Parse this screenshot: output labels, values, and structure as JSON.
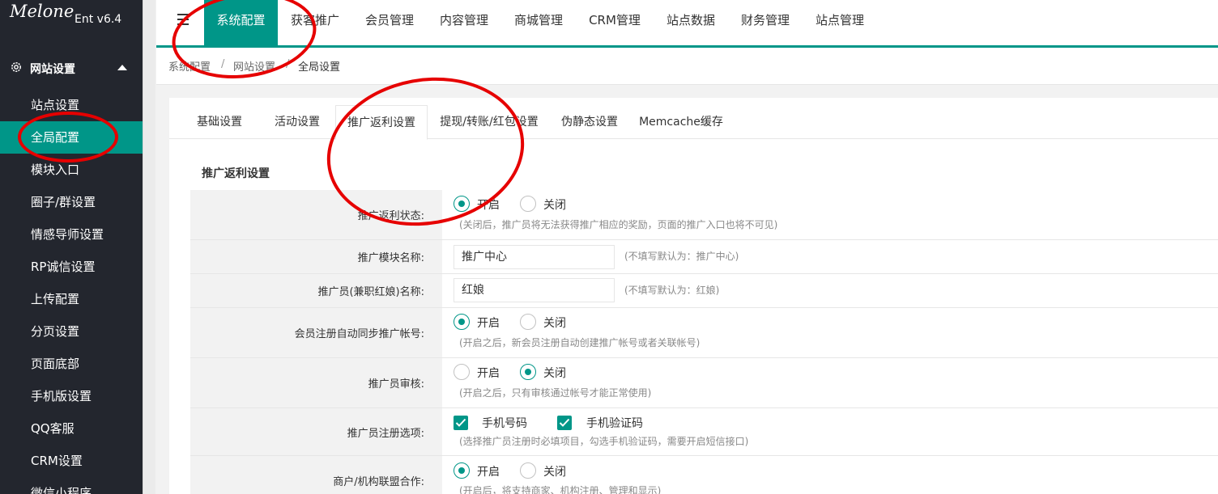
{
  "logo": {
    "script": "Melone",
    "version": "Ent v6.4"
  },
  "sidebar": {
    "group_label": "网站设置",
    "items": [
      {
        "label": "站点设置"
      },
      {
        "label": "全局配置",
        "active": true
      },
      {
        "label": "模块入口"
      },
      {
        "label": "圈子/群设置"
      },
      {
        "label": "情感导师设置"
      },
      {
        "label": "RP诚信设置"
      },
      {
        "label": "上传配置"
      },
      {
        "label": "分页设置"
      },
      {
        "label": "页面底部"
      },
      {
        "label": "手机版设置"
      },
      {
        "label": "QQ客服"
      },
      {
        "label": "CRM设置"
      },
      {
        "label": "微信小程序"
      }
    ]
  },
  "topnav": {
    "items": [
      {
        "label": "系统配置",
        "active": true
      },
      {
        "label": "获客推广"
      },
      {
        "label": "会员管理"
      },
      {
        "label": "内容管理"
      },
      {
        "label": "商城管理"
      },
      {
        "label": "CRM管理"
      },
      {
        "label": "站点数据"
      },
      {
        "label": "财务管理"
      },
      {
        "label": "站点管理"
      }
    ]
  },
  "breadcrumb": [
    "系统配置",
    "网站设置",
    "全局设置"
  ],
  "breadcrumb_sep": "/",
  "tabs": [
    {
      "label": "基础设置"
    },
    {
      "label": "活动设置"
    },
    {
      "label": "推广返利设置",
      "active": true
    },
    {
      "label": "提现/转账/红包设置"
    },
    {
      "label": "伪静态设置"
    },
    {
      "label": "Memcache缓存"
    }
  ],
  "section_title": "推广返利设置",
  "form": {
    "rebate_status": {
      "label": "推广返利状态:",
      "opt_on": "开启",
      "opt_off": "关闭",
      "selected": "开启",
      "hint": "(关闭后，推广员将无法获得推广相应的奖励，页面的推广入口也将不可见)"
    },
    "module_name": {
      "label": "推广模块名称:",
      "value": "推广中心",
      "hint": "(不填写默认为：推广中心)"
    },
    "promoter_name": {
      "label": "推广员(兼职红娘)名称:",
      "value": "红娘",
      "hint": "(不填写默认为：红娘)"
    },
    "auto_sync": {
      "label": "会员注册自动同步推广帐号:",
      "opt_on": "开启",
      "opt_off": "关闭",
      "selected": "开启",
      "hint": "(开启之后，新会员注册自动创建推广帐号或者关联帐号)"
    },
    "promoter_review": {
      "label": "推广员审核:",
      "opt_on": "开启",
      "opt_off": "关闭",
      "selected": "关闭",
      "hint": "(开启之后，只有审核通过帐号才能正常使用)"
    },
    "register_options": {
      "label": "推广员注册选项:",
      "opt_phone": "手机号码",
      "opt_code": "手机验证码",
      "phone_checked": true,
      "code_checked": true,
      "hint": "(选择推广员注册时必填项目，勾选手机验证码，需要开启短信接口)"
    },
    "merchant_alliance": {
      "label": "商户/机构联盟合作:",
      "opt_on": "开启",
      "opt_off": "关闭",
      "selected": "开启",
      "hint": "(开启后，将支持商家、机构注册、管理和显示)"
    }
  },
  "colors": {
    "accent": "#009688",
    "sidebar_bg": "#23262e",
    "annotation": "#e60000"
  }
}
